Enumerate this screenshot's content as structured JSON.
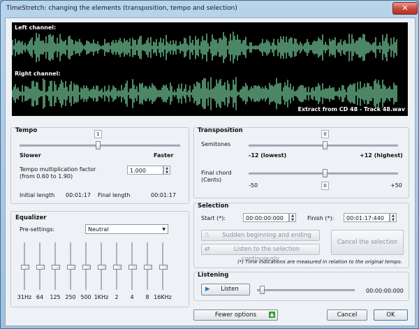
{
  "window": {
    "title": "TimeStretch: changing the elements (transposition, tempo and selection)",
    "close_glyph": "✕"
  },
  "waveform": {
    "left_label": "Left channel:",
    "right_label": "Right channel:",
    "extract_label": "Extract from CD 48 - Track 48.wav",
    "color": "#7ee0a8"
  },
  "tempo": {
    "title": "Tempo",
    "slider_value": "1",
    "slower": "Slower",
    "faster": "Faster",
    "factor_label_1": "Tempo multiplication factor",
    "factor_label_2": "(from 0.60 to 1.90)",
    "factor_value": "1.000",
    "initial_length_label": "Initial length",
    "initial_length_value": "00:01:17",
    "final_length_label": "Final length",
    "final_length_value": "00:01:17"
  },
  "transposition": {
    "title": "Transposition",
    "semitones_value": "0",
    "semitones_label": "Semitones",
    "min_label": "-12 (lowest)",
    "max_label": "+12 (highest)",
    "final_chord_label_1": "Final chord",
    "final_chord_label_2": "(Cents)",
    "cents_min": "-50",
    "cents_value": "0",
    "cents_max": "+50"
  },
  "equalizer": {
    "title": "Equalizer",
    "presettings_label": "Pre-settings:",
    "preset_value": "Neutral",
    "bands": [
      "31Hz",
      "64",
      "125",
      "250",
      "500",
      "1KHz",
      "2",
      "4",
      "8",
      "16KHz"
    ]
  },
  "selection": {
    "title": "Selection",
    "start_label": "Start (*):",
    "start_value": "00:00:00:000",
    "finish_label": "Finish (*):",
    "finish_value": "00:01:17:440",
    "sudden_label": "Sudden beginning and ending",
    "listen_continuous_label": "Listen to the selection continuously",
    "cancel_selection_label": "Cancel the selection",
    "note": "(*) Time indications are measured in relation to the original tempo."
  },
  "listening": {
    "title": "Listening",
    "listen_label": "Listen",
    "time_value": "00:00:00:000"
  },
  "footer": {
    "fewer_options_label": "Fewer options",
    "cancel_label": "Cancel",
    "ok_label": "OK"
  }
}
